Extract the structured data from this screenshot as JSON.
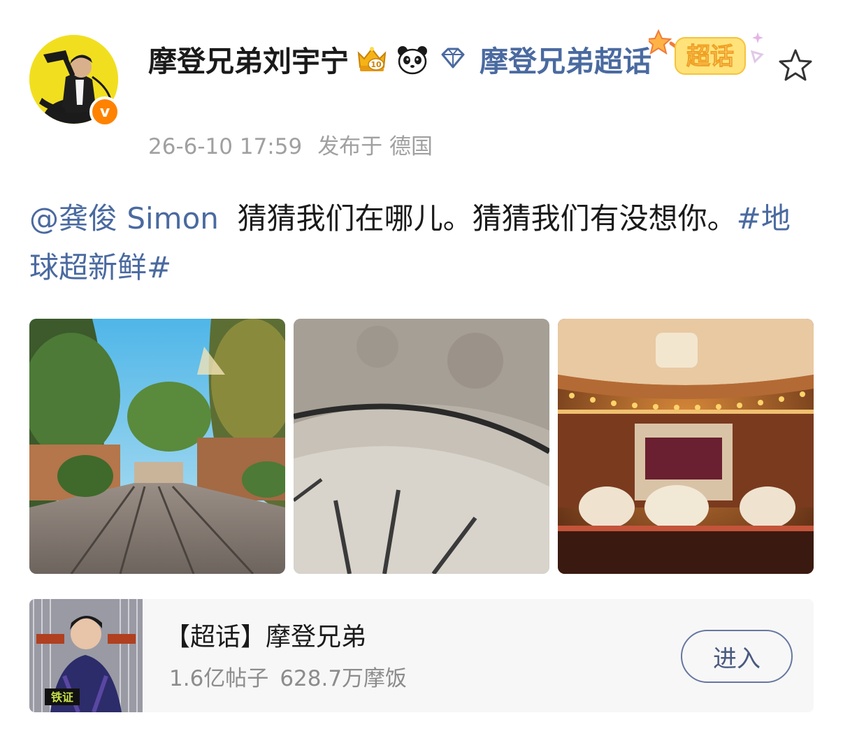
{
  "post": {
    "username": "摩登兄弟刘宇宁",
    "topic_link": "摩登兄弟超话",
    "verified_mark": "v",
    "supertopic_tag": "超话",
    "timestamp": "26-6-10 17:59",
    "location": "发布于 德国",
    "mention": "@龚俊 Simon",
    "body": "猜猜我们在哪儿。猜猜我们有没想你。",
    "hashtag": "#地球超新鲜#",
    "badges": [
      "crown-10-icon",
      "panda-icon",
      "diamond-icon"
    ],
    "action_icon": "star-icon"
  },
  "photos": [
    {
      "subject": "cobblestone-street-photo"
    },
    {
      "subject": "stone-stair-photo"
    },
    {
      "subject": "carousel-photo"
    }
  ],
  "card": {
    "title": "【超话】摩登兄弟",
    "posts_count": "1.6亿帖子",
    "fans_count": "628.7万摩饭",
    "enter_label": "进入"
  },
  "colors": {
    "link": "#4a6aa0",
    "text": "#1a1a1a",
    "meta": "#a0a0a0",
    "card_bg": "#f7f7f7",
    "verified": "#ff8200"
  }
}
